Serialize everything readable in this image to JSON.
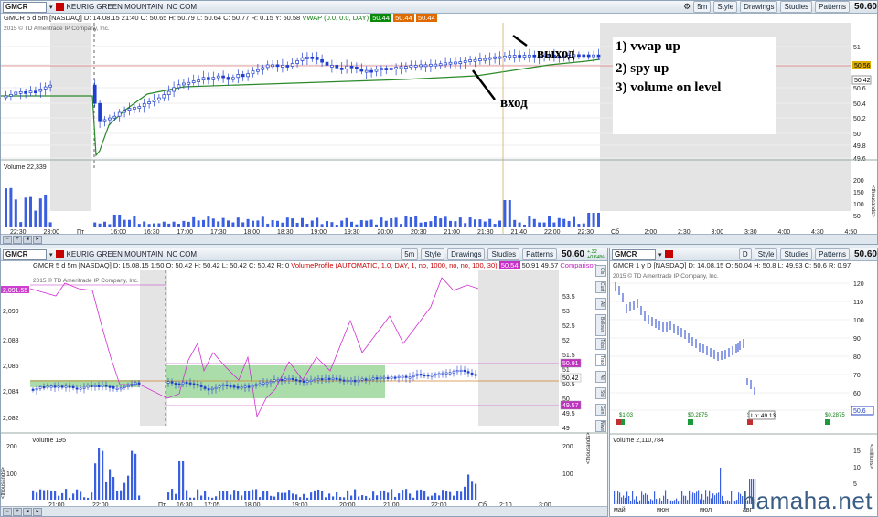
{
  "top": {
    "symbol": "GMCR",
    "info": "GMCR 5 d 5m [NASDAQ]  D: 14.08.15 21:40  O: 50.65  H: 50.79  L: 50.64  C: 50.77  R: 0.15  Y: 50.58",
    "vwap": "VWAP (0.0, 0.0, DAY)",
    "vwap_vals": [
      "50.44",
      "50.44",
      "50.44"
    ],
    "company": "KEURIG GREEN MOUNTAIN INC COM",
    "copyright": "2015 © TD Ameritrade IP Company, Inc.",
    "buttons": [
      "5m",
      "Style",
      "Drawings",
      "Studies",
      "Patterns"
    ],
    "last": "50.60",
    "price_ticks": [
      "51",
      "50.8",
      "50.6",
      "50.4",
      "50.2",
      "50",
      "49.8",
      "49.6"
    ],
    "price_labels": [
      "50.56",
      "50.42"
    ],
    "volume_label": "Volume",
    "volume_value": "22,339",
    "volume_ticks": [
      "200",
      "150",
      "100",
      "50"
    ],
    "thousands": "<thousands>",
    "time_ticks": [
      "22:30",
      "23:00",
      "Пт",
      "16:00",
      "16:30",
      "17:00",
      "17:30",
      "18:00",
      "18:30",
      "19:00",
      "19:30",
      "20:00",
      "20:30",
      "21:00",
      "21:30",
      "21:40",
      "22:00",
      "22:30",
      "Сб",
      "2:00",
      "2:30",
      "3:00",
      "3:30",
      "4:00",
      "4:30",
      "4:50"
    ]
  },
  "annotations": {
    "exit": "выход",
    "entry": "вход",
    "reasons": [
      "1) vwap up",
      "2) spy up",
      "3) volume on level"
    ]
  },
  "bl": {
    "symbol": "GMCR",
    "company": "KEURIG GREEN MOUNTAIN INC COM",
    "info": "GMCR 5 d 5m [NASDAQ]  D: 15.08.15 1:50  O: 50.42  H: 50.42  L: 50.42  C: 50.42  R: 0",
    "study": "VolumeProfile (AUTOMATIC, 1.0, DAY, 1, no, 1000, no, no, 100, 30)",
    "study_vals": [
      "50.54",
      "50.91",
      "49.57"
    ],
    "comparison": "Comparison ...",
    "copyright": "2015 © TD Ameritrade IP Company, Inc.",
    "buttons": [
      "5m",
      "Style",
      "Drawings",
      "Studies",
      "Patterns"
    ],
    "last": "50.60",
    "change_up": "+.32",
    "change_pct": "+0.64%",
    "left_tag": "2,091.55",
    "left_ticks": [
      "2,090",
      "2,088",
      "2,086",
      "2,084",
      "2,082"
    ],
    "right_ticks": [
      "53.5",
      "53",
      "52.5",
      "52",
      "51.5",
      "51",
      "50.5",
      "50",
      "49.5",
      "49"
    ],
    "right_labels": [
      "50.91",
      "50.42",
      "49.57"
    ],
    "volume_label": "Volume",
    "volume_value": "195",
    "volume_ticks": [
      "200",
      "100"
    ],
    "thousands": "<thousands>",
    "time_ticks": [
      "21:00",
      "22:00",
      "Пт",
      "16:30",
      "17:05",
      "18:00",
      "19:00",
      "20:00",
      "21:00",
      "22:00",
      "Сб",
      "2:10",
      "3:00"
    ]
  },
  "sidebar": [
    "Cls",
    "Cust",
    "All",
    "Bellows",
    "Tabs",
    "Trade",
    "All",
    "Std",
    "Gen",
    "News"
  ],
  "br": {
    "symbol": "GMCR",
    "info": "GMCR 1 y D [NASDAQ]  D: 14.08.15  O: 50.04  H: 50.8  L: 49.93  C: 50.6  R: 0.97",
    "copyright": "2015 © TD Ameritrade IP Company, Inc.",
    "period": "D",
    "buttons": [
      "Style",
      "Studies",
      "Patterns"
    ],
    "last": "50.60",
    "price_ticks": [
      "120",
      "110",
      "100",
      "90",
      "80",
      "70",
      "60",
      "50"
    ],
    "price_tag": "50.6",
    "dividends": [
      "$1.03",
      "$0.2875",
      "$0.2875",
      "$0.2875"
    ],
    "low_label": "Lo: 49.13",
    "volume_label": "Volume",
    "volume_value": "2,110,784",
    "volume_ticks": [
      "15",
      "10",
      "5"
    ],
    "thousands": "<millions>",
    "time_ticks": [
      "май",
      "июн",
      "июл",
      "авг"
    ]
  },
  "watermark": "hamaha.net",
  "colors": {
    "candle": "#1f3fcf",
    "vwap": "#2a8a2a",
    "comparison": "#d030d0",
    "profile": "#8ed18e",
    "volume": "#3a5fe0",
    "shade": "#e4e4e4"
  }
}
